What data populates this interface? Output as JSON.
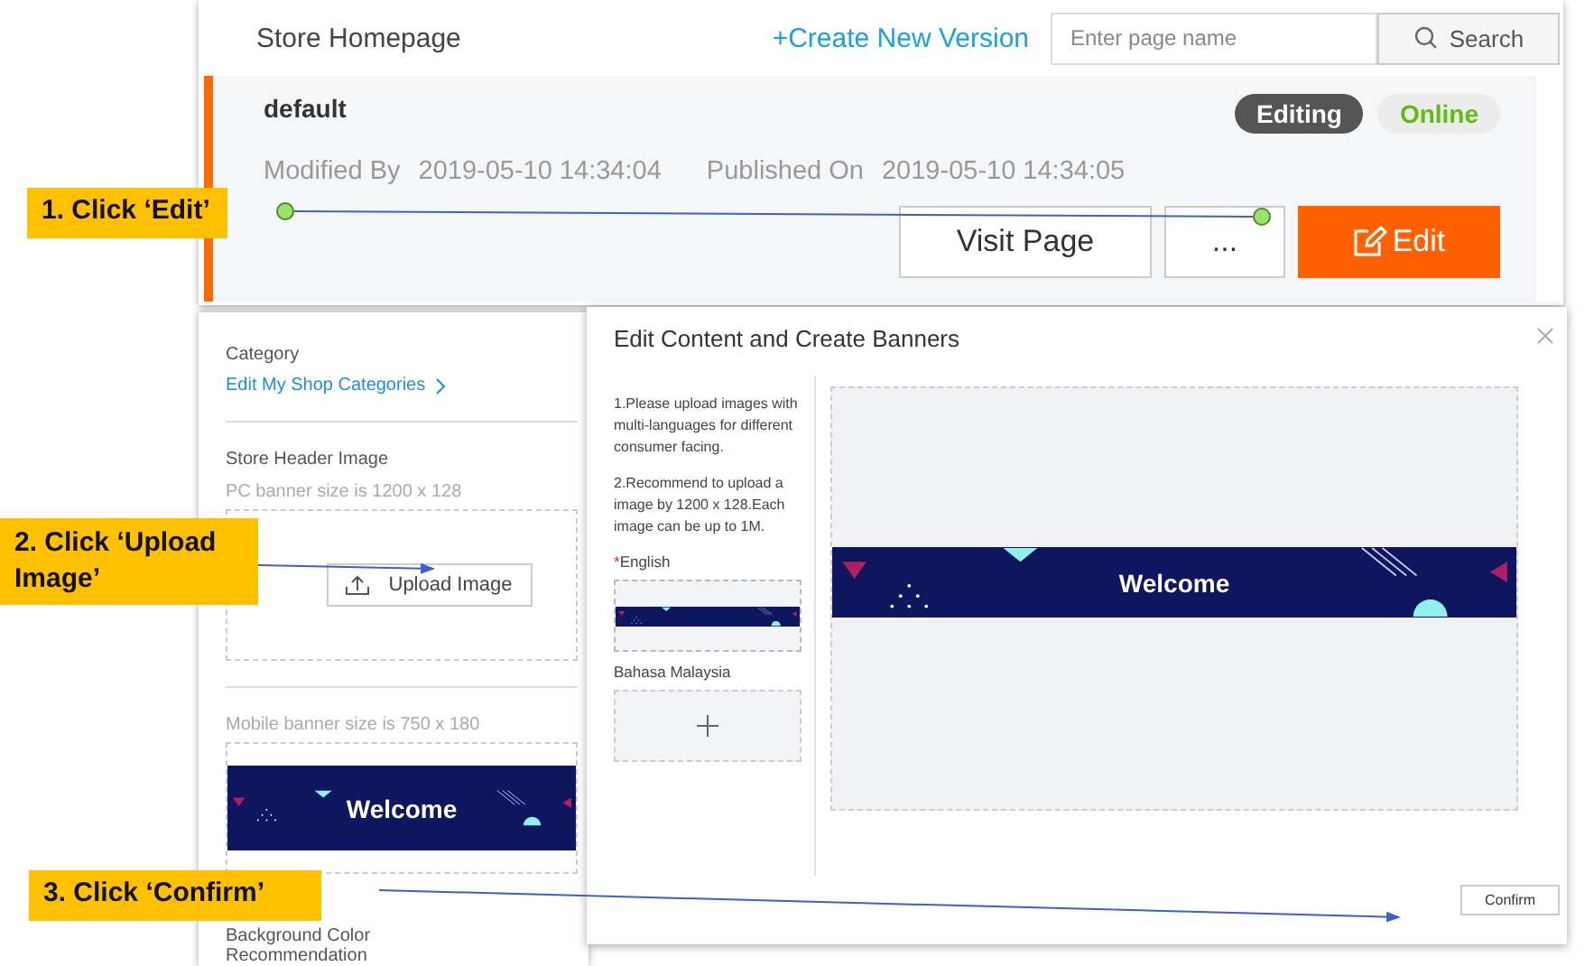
{
  "store_header": {
    "title": "Store Homepage",
    "create_link": "+Create New Version",
    "search": {
      "placeholder": "Enter page name",
      "button": "Search"
    }
  },
  "version_card": {
    "name": "default",
    "badges": [
      {
        "label": "Editing",
        "kind": "dark"
      },
      {
        "label": "Online",
        "kind": "light"
      }
    ],
    "modified_label": "Modified By",
    "modified_value": "2019-05-10 14:34:04",
    "published_label": "Published On",
    "published_value": "2019-05-10 14:34:05",
    "buttons": [
      {
        "label": "Visit Page",
        "kind": "plain"
      },
      {
        "label": "...",
        "kind": "plain"
      },
      {
        "label": "Edit",
        "kind": "primary"
      }
    ]
  },
  "settings_panel": {
    "category_label": "Category",
    "category_link": "Edit My Shop Categories",
    "header_image_label": "Store Header Image",
    "pc_hint": "PC banner size is 1200 x 128",
    "upload_button": "Upload Image",
    "mobile_hint": "Mobile banner size is 750 x 180",
    "mobile_banner_text": "Welcome",
    "background_label": "Background Color",
    "recommendation_label": "Recommendation"
  },
  "dialog": {
    "title": "Edit Content and Create Banners",
    "notes": [
      "1.Please upload images with multi-languages for different consumer facing.",
      "2.Recommend to upload a image by 1200 x 128.Each image can be up to 1M."
    ],
    "languages": [
      {
        "name": "English",
        "required_mark": "*",
        "has_image": true,
        "selected": true
      },
      {
        "name": "Bahasa Malaysia",
        "has_image": false,
        "selected": false
      }
    ],
    "preview_text": "Welcome",
    "confirm": "Confirm"
  },
  "callouts": [
    {
      "label": "1. Click ‘Edit’"
    },
    {
      "label": "2. Click ‘Upload Image’"
    },
    {
      "label": "3. Click ‘Confirm’"
    }
  ]
}
